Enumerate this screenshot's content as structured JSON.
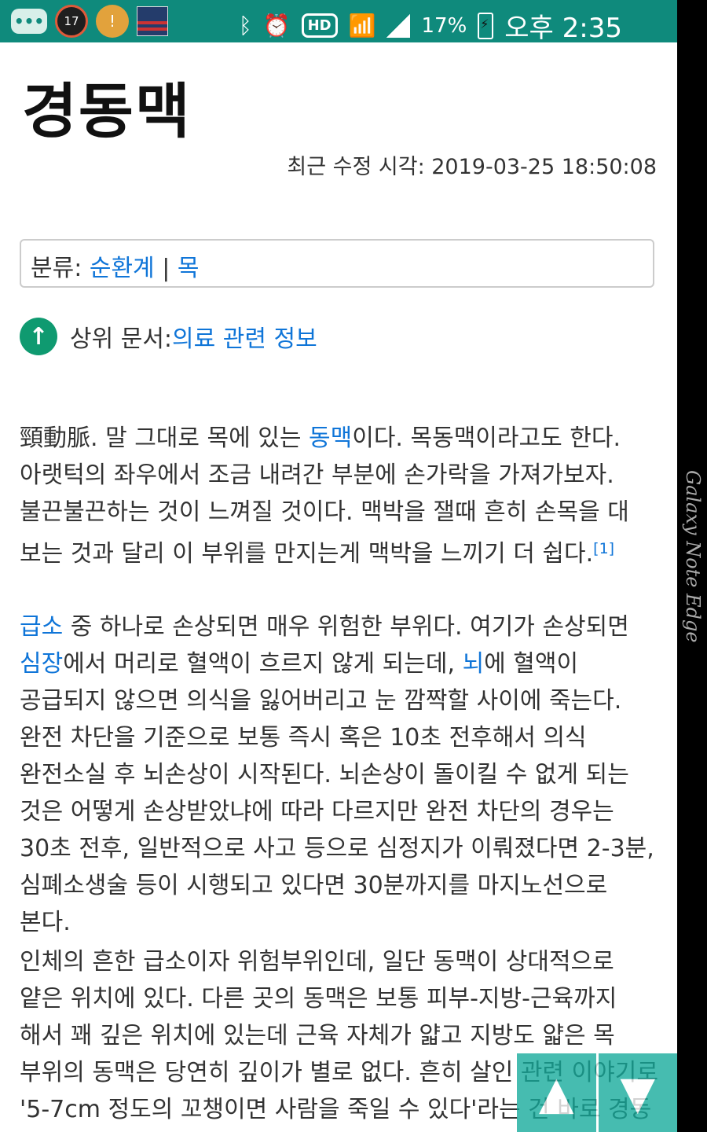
{
  "status_bar": {
    "notification_badge": "17",
    "battery_percent": "17%",
    "time": "오후 2:35",
    "network_label": "HD",
    "accent_color": "#0f8a7c",
    "icons": [
      "chat-icon",
      "notification-17-icon",
      "alert-icon",
      "flag-icon",
      "bluetooth-icon",
      "alarm-icon",
      "hd-icon",
      "wifi-icon",
      "signal-icon",
      "battery-icon"
    ]
  },
  "page": {
    "title": "경동맥",
    "last_edited": "최근 수정 시각: 2019-03-25 18:50:08"
  },
  "categories": {
    "label": "분류: ",
    "items": [
      "순환계",
      "목"
    ],
    "separator": " | "
  },
  "parent_doc": {
    "label": "상위 문서: ",
    "link": "의료 관련 정보"
  },
  "content": {
    "p1": {
      "part1": "頸動脈. 말 그대로 목에 있는 ",
      "link1": "동맥",
      "part2": "이다. 목동맥이라고도 한다. 아랫턱의 좌우에서 조금 내려간 부분에 손가락을 가져가보자. 불끈불끈하는 것이 느껴질 것이다. 맥박을 잴때 흔히 손목을 대 보는 것과 달리 이 부위를 만지는게 맥박을 느끼기 더 쉽다.",
      "footnote": "[1]"
    },
    "p2": {
      "link1": "급소",
      "part1": " 중 하나로 손상되면 매우 위험한 부위다. 여기가 손상되면 ",
      "link2": "심장",
      "part2": "에서 머리로 혈액이 흐르지 않게 되는데, ",
      "link3": "뇌",
      "part3": "에 혈액이 공급되지 않으면 의식을 잃어버리고 눈 깜짝할 사이에 죽는다. 완전 차단을 기준으로 보통 즉시 혹은 10초 전후해서 의식 완전소실 후 뇌손상이 시작된다. 뇌손상이 돌이킬 수 없게 되는 것은 어떻게 손상받았냐에 따라 다르지만 완전 차단의 경우는 30초 전후, 일반적으로 사고 등으로 심정지가 이뤄졌다면 2-3분, 심폐소생술 등이 시행되고 있다면 30분까지를 마지노선으로 본다."
    },
    "p3": {
      "text": "인체의 흔한 급소이자 위험부위인데, 일단 동맥이 상대적으로 얕은 위치에 있다. 다른 곳의 동맥은 보통 피부-지방-근육까지 해서 꽤 깊은 위치에 있는데 근육 자체가 얇고 지방도 얇은 목 부위의 동맥은 당연히 깊이가 별로 없다. 흔히 살인 관련 이야기로 '5-7cm 정도의 꼬챙이면 사람을 죽일 수 있다'라는 건 바로 경동"
    }
  },
  "scroll": {
    "up_icon": "▲",
    "down_icon": "▼"
  },
  "device": {
    "edge_label": "Galaxy Note Edge"
  }
}
